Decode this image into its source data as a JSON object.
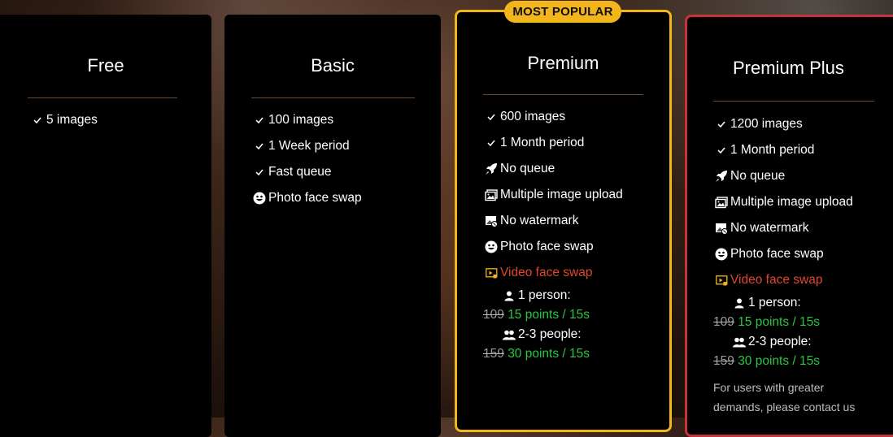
{
  "badge": "MOST POPULAR",
  "plans": {
    "free": {
      "name": "Free",
      "features": [
        "5 images"
      ]
    },
    "basic": {
      "name": "Basic",
      "features": [
        "100 images",
        "1 Week period",
        "Fast queue",
        "Photo face swap"
      ]
    },
    "premium": {
      "name": "Premium",
      "features": [
        "600 images",
        "1 Month period",
        "No queue",
        "Multiple image upload",
        "No watermark",
        "Photo face swap",
        "Video face swap"
      ],
      "video": {
        "one_person_label": "1 person:",
        "one_person_old": "109",
        "one_person_new": "15 points / 15s",
        "group_label": "2-3 people:",
        "group_old": "159",
        "group_new": "30 points / 15s"
      }
    },
    "plus": {
      "name": "Premium Plus",
      "features": [
        "1200 images",
        "1 Month period",
        "No queue",
        "Multiple image upload",
        "No watermark",
        "Photo face swap",
        "Video face swap"
      ],
      "video": {
        "one_person_label": "1 person:",
        "one_person_old": "109",
        "one_person_new": "15 points / 15s",
        "group_label": "2-3 people:",
        "group_old": "159",
        "group_new": "30 points / 15s"
      },
      "note": "For users with greater demands, please contact us"
    }
  },
  "colors": {
    "popular_border": "#f2b51c",
    "plus_border": "#c8323a",
    "video_label": "#e2452e",
    "discount_price": "#28c840"
  }
}
